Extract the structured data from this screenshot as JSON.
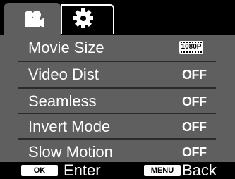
{
  "tabs": [
    {
      "icon": "camera-icon",
      "active": true
    },
    {
      "icon": "gear-icon",
      "active": false
    }
  ],
  "menu": {
    "items": [
      {
        "label": "Movie Size",
        "value": "1080P"
      },
      {
        "label": "Video Dist",
        "value": "OFF"
      },
      {
        "label": "Seamless",
        "value": "OFF"
      },
      {
        "label": "Invert Mode",
        "value": "OFF"
      },
      {
        "label": "Slow Motion",
        "value": "OFF"
      }
    ]
  },
  "footer": {
    "ok_key": "OK",
    "ok_label": "Enter",
    "menu_key": "MENU",
    "menu_label": "Back"
  },
  "colors": {
    "panel": "#5f5f5f",
    "background": "#000000",
    "text": "#ffffff"
  }
}
